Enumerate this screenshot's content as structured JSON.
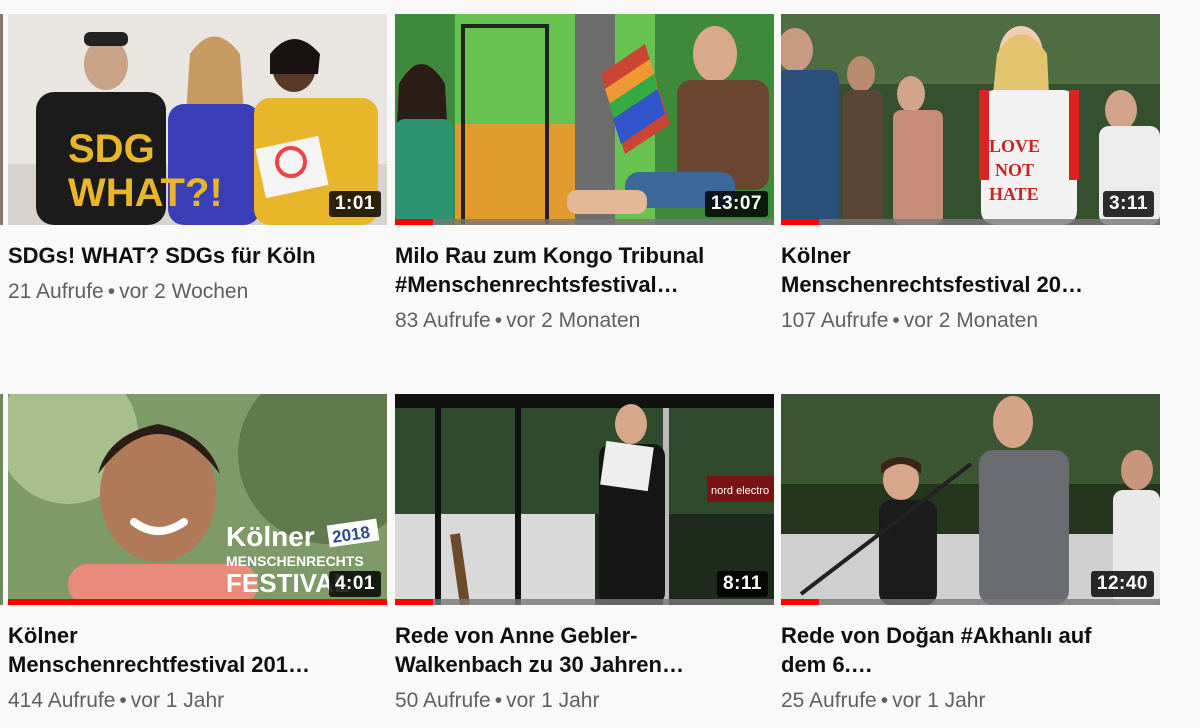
{
  "colors": {
    "progress": "#ff0000",
    "title": "#0f0f0f",
    "meta": "#606060",
    "background": "#f9f9f9"
  },
  "videos": [
    {
      "title": "SDGs! WHAT? SDGs für Köln",
      "views": "21 Aufrufe",
      "age": "vor 2 Wochen",
      "duration": "1:01",
      "watched_fraction": 0,
      "thumb_text": [
        "SDG",
        "WHAT?!"
      ]
    },
    {
      "title": "Milo Rau zum Kongo Tribunal\n#Menschenrechtsfestival…",
      "views": "83 Aufrufe",
      "age": "vor 2 Monaten",
      "duration": "13:07",
      "watched_fraction": 0.1
    },
    {
      "title": "Kölner\nMenschenrechtsfestival 20…",
      "views": "107 Aufrufe",
      "age": "vor 2 Monaten",
      "duration": "3:11",
      "watched_fraction": 0.1,
      "thumb_text": [
        "LOVE",
        "NOT",
        "HATE"
      ]
    },
    {
      "title": "Kölner\nMenschenrechtfestival 201…",
      "views": "414 Aufrufe",
      "age": "vor 1 Jahr",
      "duration": "4:01",
      "watched_fraction": 1,
      "thumb_text": [
        "Kölner",
        "2018",
        "MENSCHENRECHTS",
        "FESTIVAL"
      ]
    },
    {
      "title": "Rede von Anne Gebler-\nWalkenbach zu 30 Jahren…",
      "views": "50 Aufrufe",
      "age": "vor 1 Jahr",
      "duration": "8:11",
      "watched_fraction": 0.1,
      "thumb_text": [
        "nord electro"
      ]
    },
    {
      "title": "Rede von Doğan #Akhanlı auf\ndem 6.…",
      "views": "25 Aufrufe",
      "age": "vor 1 Jahr",
      "duration": "12:40",
      "watched_fraction": 0.1
    }
  ]
}
